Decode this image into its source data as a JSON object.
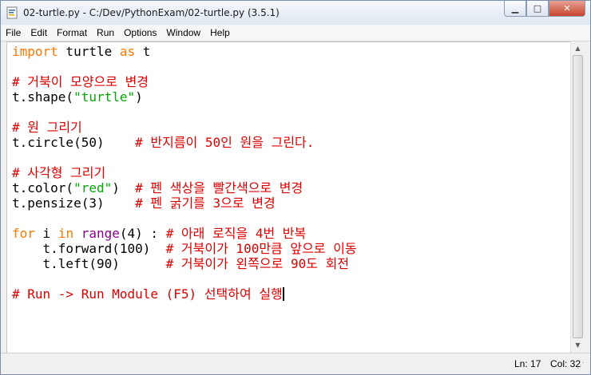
{
  "window": {
    "title": "02-turtle.py - C:/Dev/PythonExam/02-turtle.py (3.5.1)",
    "buttons": {
      "minimize": "▁",
      "maximize": "□",
      "close": "✕"
    }
  },
  "menu": [
    "File",
    "Edit",
    "Format",
    "Run",
    "Options",
    "Window",
    "Help"
  ],
  "code": {
    "l1_kw1": "import",
    "l1_mod": " turtle ",
    "l1_kw2": "as",
    "l1_alias": " t",
    "l3_comment": "# 거북이 모양으로 변경",
    "l4_pre": "t.shape(",
    "l4_str": "\"turtle\"",
    "l4_post": ")",
    "l6_comment": "# 원 그리기",
    "l7_code": "t.circle(50)    ",
    "l7_comment": "# 반지름이 50인 원을 그린다.",
    "l9_comment": "# 사각형 그리기",
    "l10_pre": "t.color(",
    "l10_str": "\"red\"",
    "l10_post": ")  ",
    "l10_comment": "# 펜 색상을 빨간색으로 변경",
    "l11_code": "t.pensize(3)    ",
    "l11_comment": "# 펜 굵기를 3으로 변경",
    "l13_kw1": "for",
    "l13_a": " i ",
    "l13_kw2": "in",
    "l13_b": " ",
    "l13_bi": "range",
    "l13_c": "(4) : ",
    "l13_comment": "# 아래 로직을 4번 반복",
    "l14_code": "    t.forward(100)  ",
    "l14_comment": "# 거북이가 100만큼 앞으로 이동",
    "l15_code": "    t.left(90)      ",
    "l15_comment": "# 거북이가 왼쪽으로 90도 회전",
    "l17_comment": "# Run -> Run Module (F5) 선택하여 실행"
  },
  "status": {
    "line": "Ln: 17",
    "col": "Col: 32"
  },
  "icons": {
    "app": "python-idle-icon",
    "scroll_up": "▲",
    "scroll_down": "▼",
    "grip": "⋰"
  }
}
